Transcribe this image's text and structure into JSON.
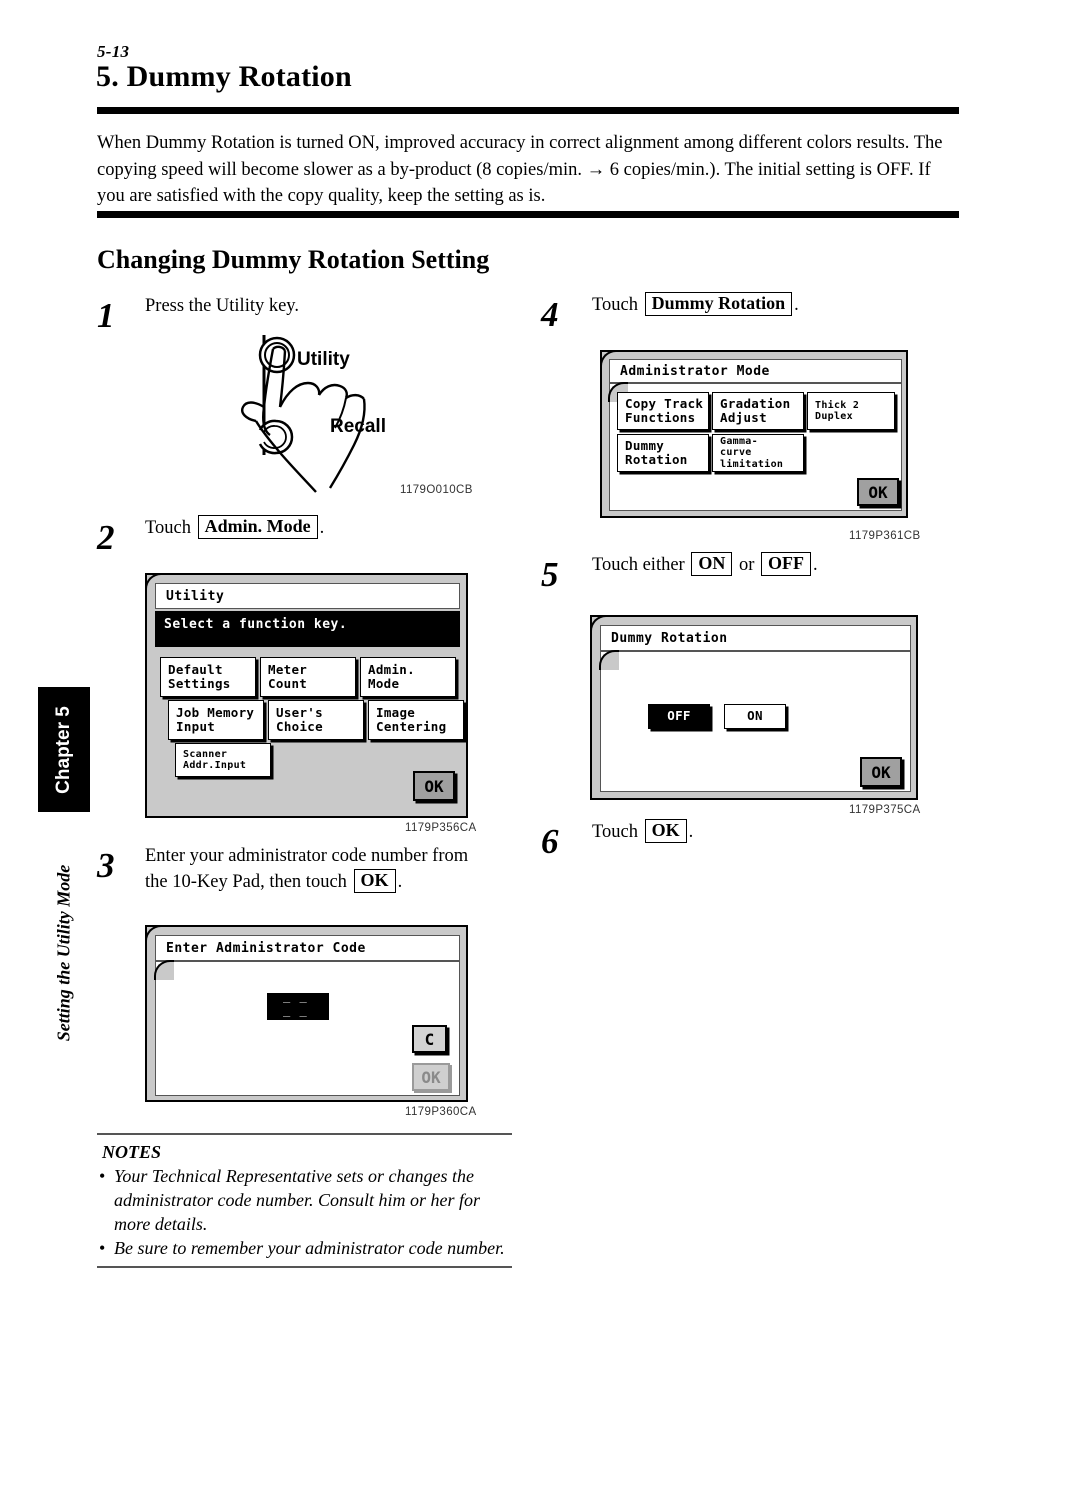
{
  "page": {
    "number": "5-13",
    "chapter_title": "5. Dummy Rotation",
    "intro": "When Dummy Rotation is turned ON, improved accuracy in correct alignment among different colors results.  The copying speed will become slower as a by-product (8 copies/min. → 6 copies/min.).  The initial setting is OFF.  If you are satisfied with the copy quality, keep the setting as is.",
    "section_heading": "Changing Dummy Rotation Setting"
  },
  "sidebar": {
    "chapter_tab": "Chapter 5",
    "vertical_label": "Setting the Utility Mode"
  },
  "steps": {
    "s1": {
      "num": "1",
      "text": "Press the Utility key."
    },
    "s2": {
      "num": "2",
      "prefix": "Touch",
      "key": "Admin. Mode",
      "suffix": "."
    },
    "s3": {
      "num": "3",
      "line1": "Enter your administrator code number from",
      "line2_prefix": "the 10-Key Pad, then touch",
      "key": "OK",
      "suffix": "."
    },
    "s4": {
      "num": "4",
      "prefix": "Touch",
      "key": "Dummy Rotation",
      "suffix": "."
    },
    "s5": {
      "num": "5",
      "prefix": "Touch either",
      "key1": "ON",
      "middle": "or",
      "key2": "OFF",
      "suffix": "."
    },
    "s6": {
      "num": "6",
      "prefix": "Touch",
      "key": "OK",
      "suffix": "."
    }
  },
  "figures": {
    "hand": {
      "label_utility": "Utility",
      "label_recall": "Recall",
      "code": "1179O010CB"
    },
    "utility_panel": {
      "title": "Utility",
      "message": "Select a function key.",
      "buttons": [
        "Default\nSettings",
        "Meter\nCount",
        "Admin.\nMode",
        "Job Memory\nInput",
        "User's\nChoice",
        "Image\nCentering",
        "Scanner\nAddr.Input"
      ],
      "ok": "OK",
      "code": "1179P356CA"
    },
    "admin_code_panel": {
      "title": "Enter Administrator Code",
      "field_value": "_ _ _ _",
      "clear": "C",
      "ok": "OK",
      "code": "1179P360CA"
    },
    "administrator_mode_panel": {
      "title": "Administrator Mode",
      "buttons": [
        "Copy Track\nFunctions",
        "Gradation\nAdjust",
        "Thick 2\nDuplex",
        "Dummy\nRotation",
        "Gamma-\ncurve\nlimitation"
      ],
      "ok": "OK",
      "code": "1179P361CB"
    },
    "dummy_rotation_panel": {
      "title": "Dummy Rotation",
      "off": "OFF",
      "on": "ON",
      "selected": "OFF",
      "ok": "OK",
      "code": "1179P375CA"
    }
  },
  "notes": {
    "title": "NOTES",
    "items": [
      "Your Technical Representative sets or changes the administrator code number.  Consult him or her for more details.",
      "Be sure to remember your administrator code number."
    ]
  }
}
